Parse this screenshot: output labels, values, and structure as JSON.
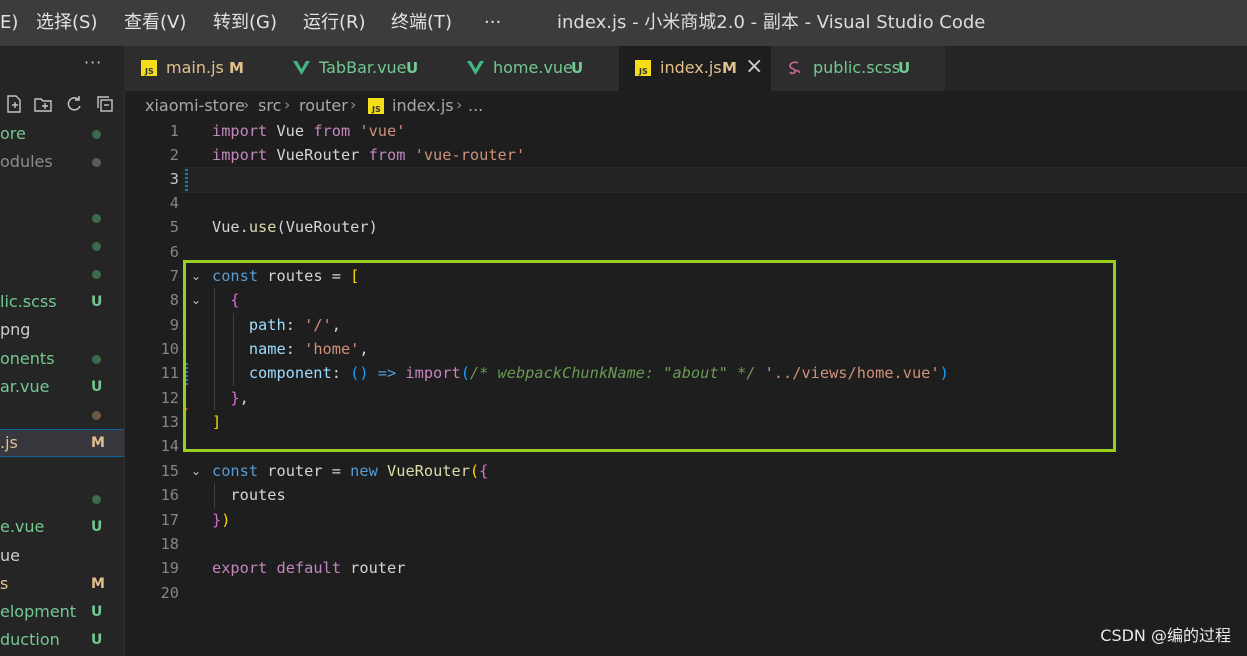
{
  "menu": [
    "E)",
    "选择(S)",
    "查看(V)",
    "转到(G)",
    "运行(R)",
    "终端(T)",
    "···"
  ],
  "window_title": "index.js - 小米商城2.0 - 副本 - Visual Studio Code",
  "sidebar": {
    "more": "···",
    "tree": [
      {
        "label": "ore",
        "color": "#73c991",
        "badge": "dot"
      },
      {
        "label": "odules",
        "color": "#8c8c8c",
        "badge": "dot-grey"
      },
      {
        "label": "",
        "badge": ""
      },
      {
        "label": "",
        "badge": "dot"
      },
      {
        "label": "",
        "badge": "dot"
      },
      {
        "label": "",
        "badge": "dot"
      },
      {
        "label": "lic.scss",
        "color": "#73c991",
        "badge": "U"
      },
      {
        "label": "png",
        "color": "#cccccc",
        "badge": ""
      },
      {
        "label": "onents",
        "color": "#73c991",
        "badge": "dot"
      },
      {
        "label": "ar.vue",
        "color": "#73c991",
        "badge": "U"
      },
      {
        "label": "",
        "badge": "dot-brown"
      },
      {
        "label": ".js",
        "color": "#e2c08d",
        "badge": "M",
        "active": true
      },
      {
        "label": "",
        "badge": ""
      },
      {
        "label": "",
        "badge": "dot"
      },
      {
        "label": "e.vue",
        "color": "#73c991",
        "badge": "U"
      },
      {
        "label": "ue",
        "color": "#cccccc",
        "badge": ""
      },
      {
        "label": "s",
        "color": "#e2c08d",
        "badge": "M"
      },
      {
        "label": "elopment",
        "color": "#73c991",
        "badge": "U"
      },
      {
        "label": "duction",
        "color": "#73c991",
        "badge": "U"
      }
    ]
  },
  "tabs": [
    {
      "label": "main.js",
      "badge": "M",
      "icon": "js-icon",
      "label_color": "#e2c08d",
      "badge_color": "#e2c08d"
    },
    {
      "label": "TabBar.vue",
      "badge": "U",
      "icon": "vue-icon",
      "label_color": "#73c991",
      "badge_color": "#73c991"
    },
    {
      "label": "home.vue",
      "badge": "U",
      "icon": "vue-icon",
      "label_color": "#73c991",
      "badge_color": "#73c991"
    },
    {
      "label": "index.js",
      "badge": "M",
      "icon": "js-icon",
      "label_color": "#e2c08d",
      "badge_color": "#e2c08d",
      "active": true
    },
    {
      "label": "public.scss",
      "badge": "U",
      "icon": "sass-icon",
      "label_color": "#73c991",
      "badge_color": "#73c991"
    }
  ],
  "breadcrumb": [
    "xiaomi-store",
    "src",
    "router",
    "index.js",
    "..."
  ],
  "line_numbers": [
    "1",
    "2",
    "3",
    "4",
    "5",
    "6",
    "7",
    "8",
    "9",
    "10",
    "11",
    "12",
    "13",
    "14",
    "15",
    "16",
    "17",
    "18",
    "19",
    "20"
  ],
  "code": {
    "l1": {
      "kw": "import",
      "a": " Vue ",
      "kw2": "from",
      "s": " ",
      "str": "'vue'"
    },
    "l2": {
      "kw": "import",
      "a": " VueRouter ",
      "kw2": "from",
      "s": " ",
      "str": "'vue-router'"
    },
    "l4": {
      "a": "Vue.",
      "fn": "use",
      "b": "(VueRouter)"
    },
    "l7": {
      "kw": "const",
      "a": " routes = ",
      "br": "["
    },
    "l8": {
      "br": "{"
    },
    "l9": {
      "prop": "path",
      "a": ": ",
      "str": "'/'",
      "b": ","
    },
    "l10": {
      "prop": "name",
      "a": ": ",
      "str": "'home'",
      "b": ","
    },
    "l11": {
      "prop": "component",
      "a": ": ",
      "p1": "()",
      "b": " => ",
      "kw": "import",
      "p2": "(",
      "cmt": "/* webpackChunkName: \"about\" */",
      "c": " ",
      "str": "'../views/home.vue'",
      "p3": ")"
    },
    "l12": {
      "br": "}",
      "b": ","
    },
    "l13": {
      "br": "]"
    },
    "l15": {
      "kw": "const",
      "a": " router = ",
      "kw2": "new",
      "b": " ",
      "fn": "VueRouter",
      "p1": "(",
      "p2": "{"
    },
    "l16": {
      "a": "routes"
    },
    "l17": {
      "p2": "}",
      "p1": ")"
    },
    "l19": {
      "kw": "export",
      "a": " ",
      "kw2": "default",
      "b": " router"
    }
  },
  "watermark": "CSDN @编的过程"
}
